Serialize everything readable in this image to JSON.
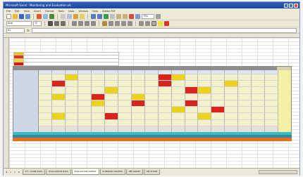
{
  "window": {
    "title": "Microsoft Excel - Monitoring and Evaluation.xls"
  },
  "menu": [
    "File",
    "Edit",
    "View",
    "Insert",
    "Format",
    "Tools",
    "Data",
    "Window",
    "Help",
    "Adobe PDF"
  ],
  "toolbar": {
    "font_name": "Arial",
    "font_size": "10",
    "zoom": "75%"
  },
  "formula_bar": {
    "name_box": "A1",
    "fx": "fx",
    "value": ""
  },
  "intro_text": "",
  "legend": [
    {
      "color": "#e8c800",
      "text": ""
    },
    {
      "color": "#e83010",
      "text": ""
    },
    {
      "color": "#e4dc3a",
      "text": ""
    },
    {
      "color": "#d81810",
      "text": ""
    }
  ],
  "heatmap": {
    "columns": 18,
    "rows": 9,
    "palette": {
      "n": "#f3f1cc",
      "y": "#ecd21a",
      "r": "#d9241c",
      "g": "#e2e2d8"
    },
    "grid": [
      "nnynnnnnnrynnnnnnn",
      "nrnnnnnnnrnnnnynnn",
      "nnnnnynnnnnrynnnnn",
      "nynnrnnynnnnnnnnnn",
      "nnnnynnrnnnrnnnnnn",
      "nnnnnnnnnnynnrnnnn",
      "nynnnrnnnnnnynnnnn",
      "nnnnnnnnnnnnnnnnnn",
      "ggggggggggggggggggg"
    ]
  },
  "sheet_tabs": [
    "DT - CORE DATA",
    "EVALUATION DATA",
    "EVALUATION MATRIX",
    "SUMMARY GRAPHS",
    "PIE GRAPH",
    "PIE CHART"
  ],
  "colors": {
    "accent": "#2e5fb8",
    "orange_band": "#e86a1c",
    "teal": "#3fb8c8"
  }
}
